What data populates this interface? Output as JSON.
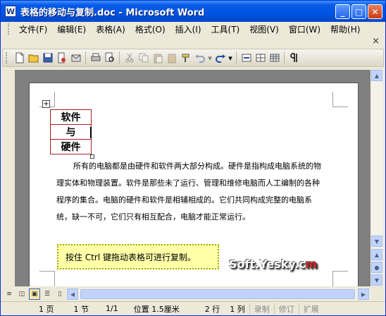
{
  "window": {
    "title": "表格的移动与复制.doc - Microsoft Word",
    "app_icon_letter": "W",
    "minimize": "_",
    "maximize": "□",
    "close": "✕"
  },
  "menubar": {
    "items": [
      {
        "label": "文件(F)"
      },
      {
        "label": "编辑(E)"
      },
      {
        "label": "表格(A)"
      },
      {
        "label": "格式(O)"
      },
      {
        "label": "插入(I)"
      },
      {
        "label": "工具(T)"
      },
      {
        "label": "视图(V)"
      },
      {
        "label": "窗口(W)"
      },
      {
        "label": "帮助(H)"
      }
    ],
    "close_glyph": "×"
  },
  "document": {
    "table_cells": [
      "软件",
      "与",
      "硬件"
    ],
    "paragraph": "所有的电脑都是由硬件和软件两大部分构成。硬件是指构成电脑系统的物理实体和物理装置。软件是那些未了运行、管理和维修电脑而人工编制的各种程序的集合。电脑的硬件和软件是相辅相成的。它们共同构成完整的电脑系统，缺一不可，它们只有相互配合，电脑才能正常运行。",
    "move_handle_glyph": "+"
  },
  "callout": {
    "text": "按住 Ctrl 键拖动表格可进行复制。"
  },
  "watermark": {
    "text": "Soft.Yesky.c",
    "tail": "m"
  },
  "statusbar": {
    "page": "1 页",
    "section": "1 节",
    "page_of": "1/1",
    "position": "位置 1.5厘米",
    "line": "2 行",
    "column": "1 列",
    "rec": "录制",
    "trk": "修订",
    "ext": "扩展"
  },
  "colors": {
    "titlebar": "#0054e3",
    "table_border": "#a02020",
    "callout_bg": "#ffffa8"
  }
}
